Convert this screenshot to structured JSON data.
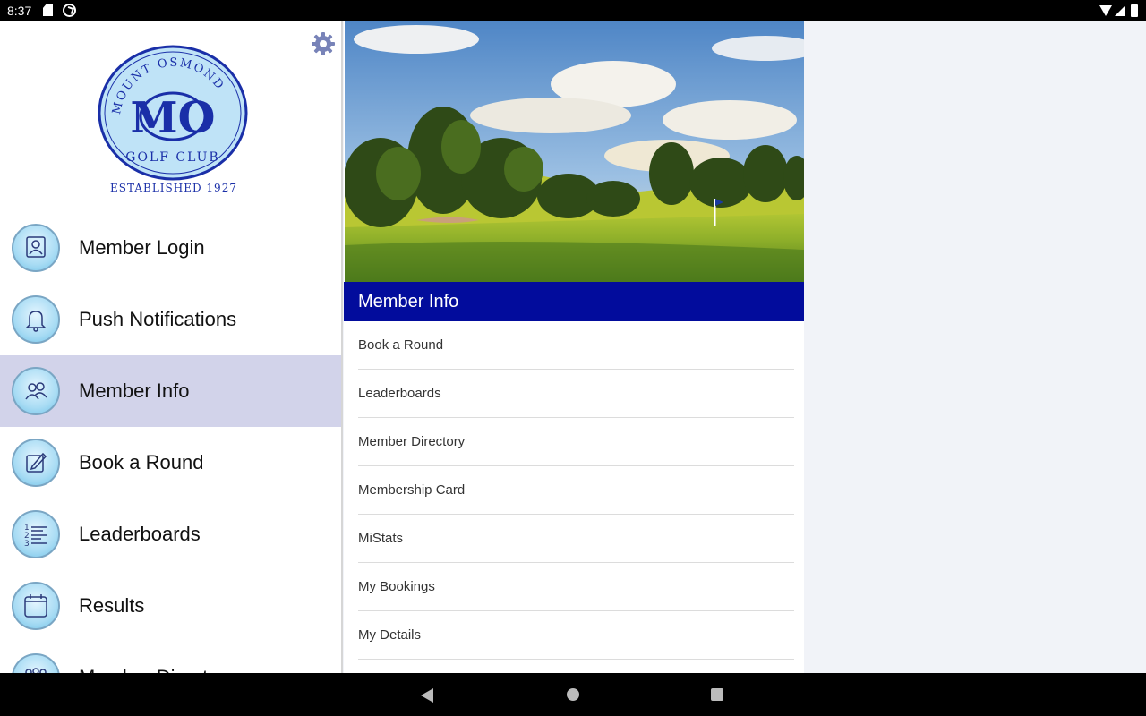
{
  "status_bar": {
    "time": "8:37",
    "icons": [
      "sd-card-icon",
      "sync-icon",
      "wifi-icon",
      "signal-icon",
      "battery-icon"
    ]
  },
  "drawer": {
    "logo": {
      "top_text": "MOUNT OSMOND",
      "monogram": "MO",
      "bottom_text": "GOLF CLUB",
      "established": "ESTABLISHED 1927"
    },
    "items": [
      {
        "label": "Member Login",
        "icon": "member-login-icon",
        "active": false
      },
      {
        "label": "Push Notifications",
        "icon": "bell-icon",
        "active": false
      },
      {
        "label": "Member Info",
        "icon": "members-icon",
        "active": true
      },
      {
        "label": "Book a Round",
        "icon": "edit-icon",
        "active": false
      },
      {
        "label": "Leaderboards",
        "icon": "numbered-list-icon",
        "active": false
      },
      {
        "label": "Results",
        "icon": "calendar-icon",
        "active": false
      },
      {
        "label": "Member Directory",
        "icon": "group-icon",
        "active": false
      }
    ]
  },
  "panel": {
    "title": "Member Info",
    "items": [
      {
        "label": "Book a Round"
      },
      {
        "label": "Leaderboards"
      },
      {
        "label": "Member Directory"
      },
      {
        "label": "Membership Card"
      },
      {
        "label": "MiStats"
      },
      {
        "label": "My Bookings"
      },
      {
        "label": "My Details"
      }
    ]
  },
  "colors": {
    "header_blue": "#020c9c",
    "active_item": "#d2d3ea",
    "logo_blue": "#1a2fa8"
  }
}
